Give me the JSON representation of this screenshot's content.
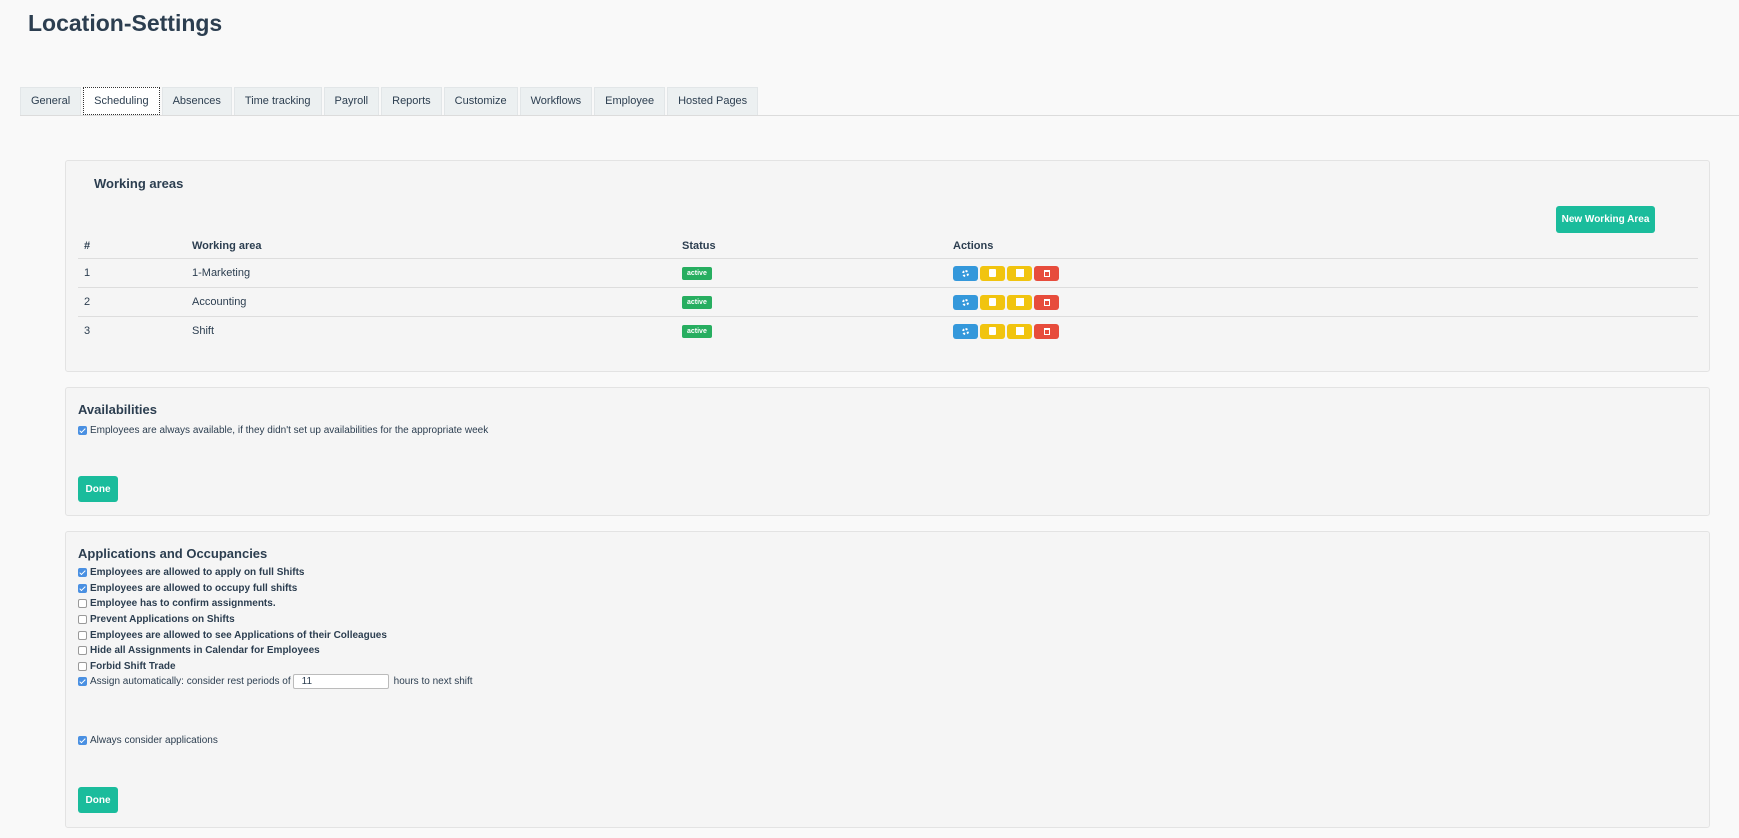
{
  "page": {
    "title": "Location-Settings"
  },
  "tabs": [
    {
      "label": "General"
    },
    {
      "label": "Scheduling",
      "active": true
    },
    {
      "label": "Absences"
    },
    {
      "label": "Time tracking"
    },
    {
      "label": "Payroll"
    },
    {
      "label": "Reports"
    },
    {
      "label": "Customize"
    },
    {
      "label": "Workflows"
    },
    {
      "label": "Employee"
    },
    {
      "label": "Hosted Pages"
    }
  ],
  "working_areas": {
    "title": "Working areas",
    "new_button": "New Working Area",
    "columns": [
      "#",
      "Working area",
      "Status",
      "Actions"
    ],
    "rows": [
      {
        "num": "1",
        "name": "1-Marketing",
        "status": "active"
      },
      {
        "num": "2",
        "name": "Accounting",
        "status": "active"
      },
      {
        "num": "3",
        "name": "Shift",
        "status": "active"
      }
    ],
    "action_icons": [
      "gear-icon",
      "document-icon",
      "calendar-icon",
      "trash-icon"
    ]
  },
  "availabilities": {
    "title": "Availabilities",
    "option": {
      "label": "Employees are always available, if they didn't set up availabilities for the appropriate week",
      "checked": true
    },
    "done_button": "Done"
  },
  "applications": {
    "title": "Applications and Occupancies",
    "options": [
      {
        "label": "Employees are allowed to apply on full Shifts",
        "checked": true
      },
      {
        "label": "Employees are allowed to occupy full shifts",
        "checked": true
      },
      {
        "label": "Employee has to confirm assignments.",
        "checked": false
      },
      {
        "label": "Prevent Applications on Shifts",
        "checked": false
      },
      {
        "label": "Employees are allowed to see Applications of their Colleagues",
        "checked": false
      },
      {
        "label": "Hide all Assignments in Calendar for Employees",
        "checked": false
      },
      {
        "label": "Forbid Shift Trade",
        "checked": false
      }
    ],
    "auto_assign": {
      "label_before": "Assign automatically: consider rest periods of",
      "value": "11",
      "label_after": "hours to next shift",
      "checked": true
    },
    "always_consider": {
      "label": "Always consider applications",
      "checked": true
    },
    "done_button": "Done"
  },
  "colors": {
    "teal": "#1abc9c",
    "blue": "#3498db",
    "yellow": "#f1c40f",
    "red": "#e74c3c",
    "green": "#27ae60"
  }
}
